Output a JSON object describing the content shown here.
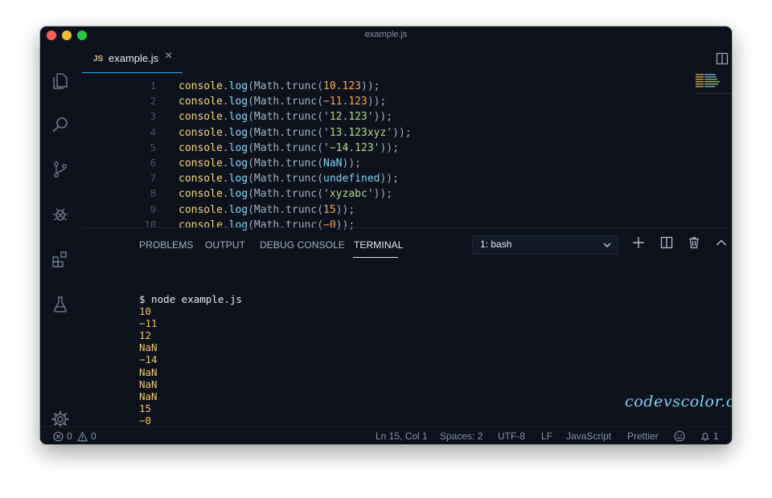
{
  "window": {
    "title": "example.js"
  },
  "activity_bar": {
    "icons": [
      "files-icon",
      "search-icon",
      "source-control-icon",
      "debug-icon",
      "extensions-icon",
      "testing-icon",
      "settings-gear-icon"
    ]
  },
  "tab": {
    "file_type_badge": "JS",
    "name": "example.js",
    "close_glyph": "×"
  },
  "tab_actions": {
    "more_glyph": "···"
  },
  "editor": {
    "lines": [
      {
        "num": "1",
        "obj": "console",
        "dot": ".",
        "fn": "log",
        "mid": "(Math.trunc(",
        "arg": "10.123",
        "arg_type": "num",
        "close": "));"
      },
      {
        "num": "2",
        "obj": "console",
        "dot": ".",
        "fn": "log",
        "mid": "(Math.trunc(",
        "arg": "−11.123",
        "arg_type": "num",
        "close": "));"
      },
      {
        "num": "3",
        "obj": "console",
        "dot": ".",
        "fn": "log",
        "mid": "(Math.trunc(",
        "arg": "'12.123'",
        "arg_type": "str",
        "close": "));"
      },
      {
        "num": "4",
        "obj": "console",
        "dot": ".",
        "fn": "log",
        "mid": "(Math.trunc(",
        "arg": "'13.123xyz'",
        "arg_type": "str",
        "close": "));"
      },
      {
        "num": "5",
        "obj": "console",
        "dot": ".",
        "fn": "log",
        "mid": "(Math.trunc(",
        "arg": "'−14.123'",
        "arg_type": "str",
        "close": "));"
      },
      {
        "num": "6",
        "obj": "console",
        "dot": ".",
        "fn": "log",
        "mid": "(Math.trunc(",
        "arg": "NaN",
        "arg_type": "kw",
        "close": "));"
      },
      {
        "num": "7",
        "obj": "console",
        "dot": ".",
        "fn": "log",
        "mid": "(Math.trunc(",
        "arg": "undefined",
        "arg_type": "kw",
        "close": "));"
      },
      {
        "num": "8",
        "obj": "console",
        "dot": ".",
        "fn": "log",
        "mid": "(Math.trunc(",
        "arg": "'xyzabc'",
        "arg_type": "str",
        "close": "));"
      },
      {
        "num": "9",
        "obj": "console",
        "dot": ".",
        "fn": "log",
        "mid": "(Math.trunc(",
        "arg": "15",
        "arg_type": "num",
        "close": "));"
      },
      {
        "num": "10",
        "obj": "console",
        "dot": ".",
        "fn": "log",
        "mid": "(Math.trunc(",
        "arg": "−0",
        "arg_type": "num",
        "close": "));"
      }
    ]
  },
  "panel": {
    "tabs": [
      {
        "label": "PROBLEMS"
      },
      {
        "label": "OUTPUT"
      },
      {
        "label": "DEBUG CONSOLE"
      },
      {
        "label": "TERMINAL"
      }
    ],
    "active_tab": "TERMINAL",
    "terminal_select": "1: bash"
  },
  "terminal": {
    "command": "$ node example.js",
    "output": [
      "10",
      "−11",
      "12",
      "NaN",
      "−14",
      "NaN",
      "NaN",
      "NaN",
      "15",
      "−0"
    ],
    "prompt": "$"
  },
  "watermark": "codevscolor.com",
  "status_bar": {
    "errors": "0",
    "warnings": "0",
    "position": "Ln 15, Col 1",
    "spaces": "Spaces: 2",
    "encoding": "UTF-8",
    "eol": "LF",
    "language": "JavaScript",
    "formatter": "Prettier",
    "notifications": "1"
  },
  "colors": {
    "background": "#0d111c",
    "accent_blue": "#3aa9f0",
    "terminal_output": "#f3c36a",
    "string": "#b8d989",
    "number": "#f7a85c",
    "object": "#f6d97a",
    "function": "#89ddff"
  }
}
